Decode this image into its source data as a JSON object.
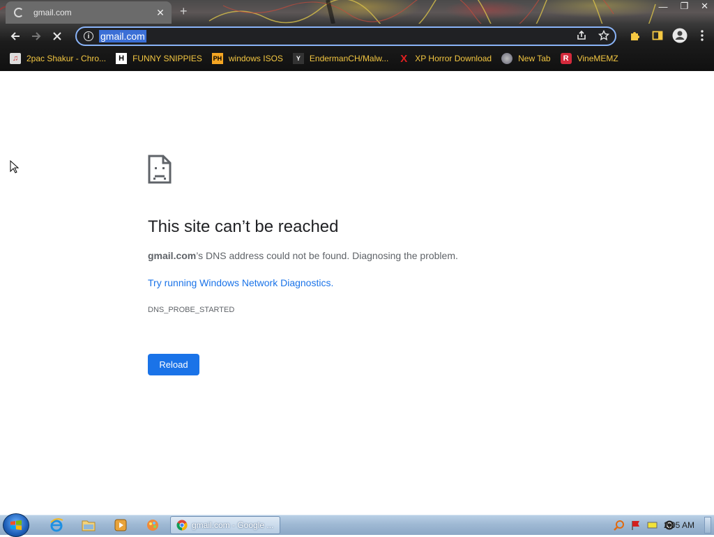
{
  "browser": {
    "tab_title": "gmail.com",
    "url": "gmail.com",
    "bookmarks": [
      {
        "label": "2pac Shakur - Chro...",
        "icon": "music-icon"
      },
      {
        "label": "FUNNY SNIPPIES",
        "icon": "h-icon"
      },
      {
        "label": "windows ISOS",
        "icon": "ph-icon"
      },
      {
        "label": "EndermanCH/Malw...",
        "icon": "y-icon"
      },
      {
        "label": "XP Horror Download",
        "icon": "x-icon"
      },
      {
        "label": "New Tab",
        "icon": "globe-icon"
      },
      {
        "label": "VineMEMZ",
        "icon": "r-icon"
      }
    ]
  },
  "error": {
    "title": "This site can’t be reached",
    "host": "gmail.com",
    "description_rest": "’s DNS address could not be found. Diagnosing the problem.",
    "link": "Try running Windows Network Diagnostics.",
    "code": "DNS_PROBE_STARTED",
    "reload_label": "Reload"
  },
  "taskbar": {
    "active_window_label": "gmail.com - Google ...",
    "clock": "2:05 AM"
  },
  "colors": {
    "accent": "#1a73e8",
    "bookmark_text": "#f5c842",
    "omnibox_focus": "#8ab4f8"
  }
}
